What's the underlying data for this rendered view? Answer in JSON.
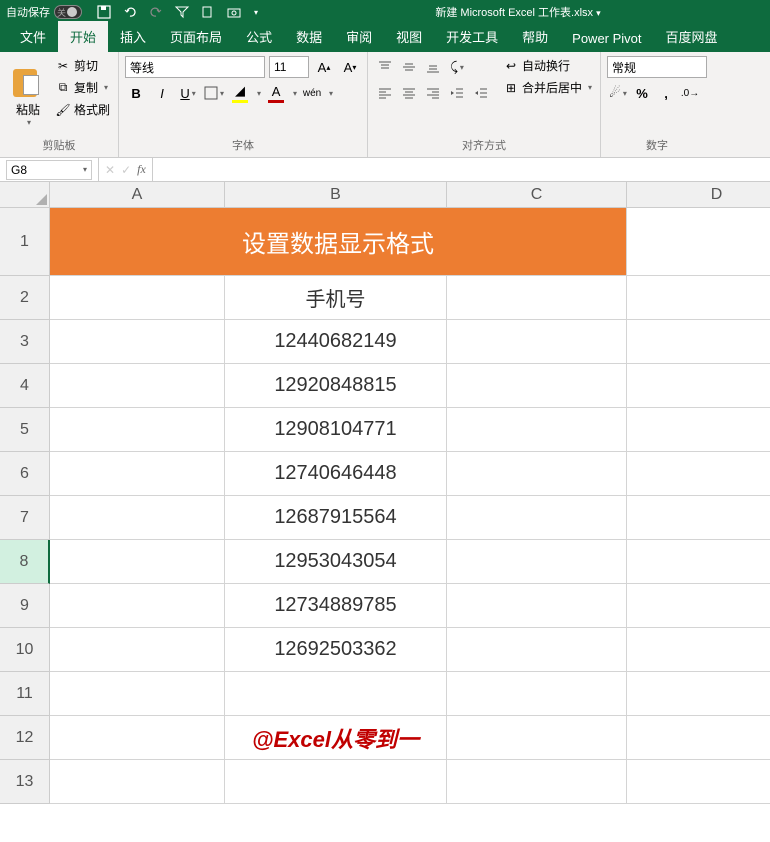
{
  "titlebar": {
    "autosave_label": "自动保存",
    "autosave_state": "关",
    "filename": "新建 Microsoft Excel 工作表.xlsx"
  },
  "tabs": {
    "file": "文件",
    "home": "开始",
    "insert": "插入",
    "layout": "页面布局",
    "formula": "公式",
    "data": "数据",
    "review": "审阅",
    "view": "视图",
    "developer": "开发工具",
    "help": "帮助",
    "powerpivot": "Power Pivot",
    "baidu": "百度网盘"
  },
  "ribbon": {
    "clipboard": {
      "paste": "粘贴",
      "cut": "剪切",
      "copy": "复制",
      "format_painter": "格式刷",
      "label": "剪贴板"
    },
    "font": {
      "font_name": "等线",
      "font_size": "11",
      "wen_label": "wén",
      "label": "字体"
    },
    "alignment": {
      "wrap_text": "自动换行",
      "merge_center": "合并后居中",
      "label": "对齐方式"
    },
    "number": {
      "format": "常规",
      "label": "数字"
    }
  },
  "namebox": "G8",
  "columns": [
    "A",
    "B",
    "C",
    "D"
  ],
  "rows": [
    "1",
    "2",
    "3",
    "4",
    "5",
    "6",
    "7",
    "8",
    "9",
    "10",
    "11",
    "12",
    "13"
  ],
  "sheet": {
    "merged_title": "设置数据显示格式",
    "b2": "手机号",
    "phone_numbers": [
      "12440682149",
      "12920848815",
      "12908104771",
      "12740646448",
      "12687915564",
      "12953043054",
      "12734889785",
      "12692503362"
    ],
    "watermark": "@Excel从零到一"
  },
  "active_row": "8"
}
